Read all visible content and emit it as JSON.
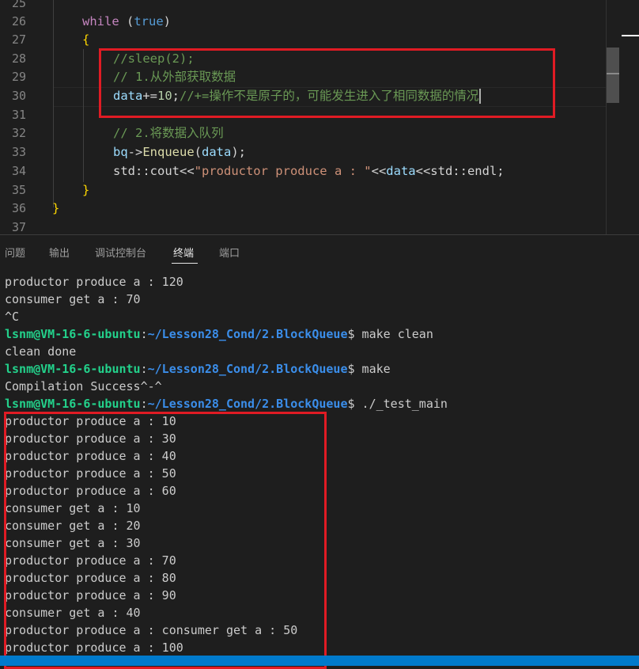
{
  "editor": {
    "line_numbers": [
      "25",
      "26",
      "27",
      "28",
      "29",
      "30",
      "31",
      "32",
      "33",
      "34",
      "35",
      "36",
      "37"
    ],
    "code": {
      "while_kw": "while",
      "while_open": " (",
      "while_true": "true",
      "while_close": ")",
      "brace_open": "{",
      "sleep_comment": "//sleep(2);",
      "step1_comment": "// 1.从外部获取数据",
      "data_var": "data",
      "data_op": "+=",
      "data_num": "10",
      "data_semicolon": ";",
      "data_comment": "//+=操作不是原子的，可能发生进入了相同数据的情况",
      "step2_comment": "// 2.将数据入队列",
      "bq_var": "bq",
      "bq_arrow": "->",
      "enqueue_fn": "Enqueue",
      "enqueue_open": "(",
      "enqueue_arg": "data",
      "enqueue_close": ");",
      "cout_ns": "std::cout<<",
      "cout_string": "\"productor produce a : \"",
      "cout_mid": "<<",
      "cout_data": "data",
      "cout_end": "<<std::endl;",
      "brace_close_inner": "}",
      "brace_close_outer": "}"
    }
  },
  "panel": {
    "tabs": [
      "问题",
      "输出",
      "调试控制台",
      "终端",
      "端口"
    ],
    "active_tab": "终端"
  },
  "terminal": {
    "prompt_user": "lsnm@VM-16-6-ubuntu",
    "prompt_path": "~/Lesson28_Cond/2.BlockQueue",
    "lines_before": [
      "productor produce a : 120",
      "consumer get a : 70",
      "^C"
    ],
    "cmd_clean": "$ make clean",
    "clean_done": "clean done",
    "cmd_make": "$ make",
    "compile_ok": "Compilation Success^-^",
    "cmd_run": "$ ./_test_main",
    "output_lines": [
      "productor produce a : 10",
      "productor produce a : 30",
      "productor produce a : 40",
      "productor produce a : 50",
      "productor produce a : 60",
      "consumer get a : 10",
      "consumer get a : 20",
      "consumer get a : 30",
      "productor produce a : 70",
      "productor produce a : 80",
      "productor produce a : 90",
      "consumer get a : 40",
      "productor produce a : consumer get a : 50",
      "productor produce a : 100"
    ]
  },
  "colors": {
    "highlight_box": "#e01b24",
    "prompt_user": "#23d18b",
    "prompt_path": "#3b8eea",
    "statusbar": "#007acc"
  }
}
